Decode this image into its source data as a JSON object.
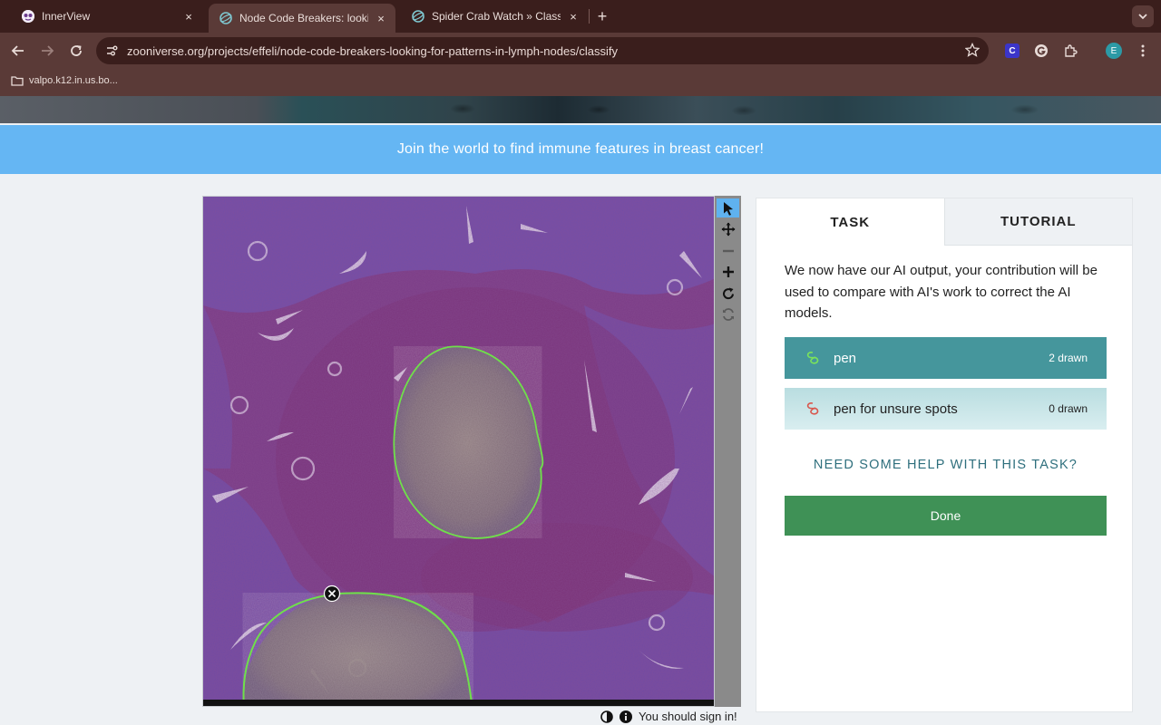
{
  "browser": {
    "tabs": [
      {
        "title": "InnerView",
        "close": "×"
      },
      {
        "title": "Node Code Breakers: looking",
        "close": "×"
      },
      {
        "title": "Spider Crab Watch » Classify",
        "close": "×"
      }
    ],
    "new_tab": "+",
    "url": "zooniverse.org/projects/effeli/node-code-breakers-looking-for-patterns-in-lymph-nodes/classify",
    "bookmark": "valpo.k12.in.us.bo...",
    "profile_initial": "E",
    "extension_c": "C",
    "accent": "#5fb2ef"
  },
  "banner": {
    "text": "Join the world to find immune features in breast cancer!",
    "color": "#65b6f3"
  },
  "panel": {
    "tabs": [
      "TASK",
      "TUTORIAL"
    ],
    "instruction": "We now have our AI output, your contribution will be used to compare with AI's work to correct the AI models.",
    "tools": [
      {
        "label": "pen",
        "count": "2 drawn",
        "icon_color": "#7be35a"
      },
      {
        "label": "pen for unsure spots",
        "count": "0 drawn",
        "icon_color": "#d9574d"
      }
    ],
    "help": "NEED SOME HELP WITH THIS TASK?",
    "done": "Done"
  },
  "viewer": {
    "status": "You should sign in!",
    "tool_icons": [
      "pointer-icon",
      "move-icon",
      "zoom-out-icon",
      "zoom-in-icon",
      "rotate-icon",
      "reset-icon"
    ],
    "outline_color": "#6fe04a"
  }
}
